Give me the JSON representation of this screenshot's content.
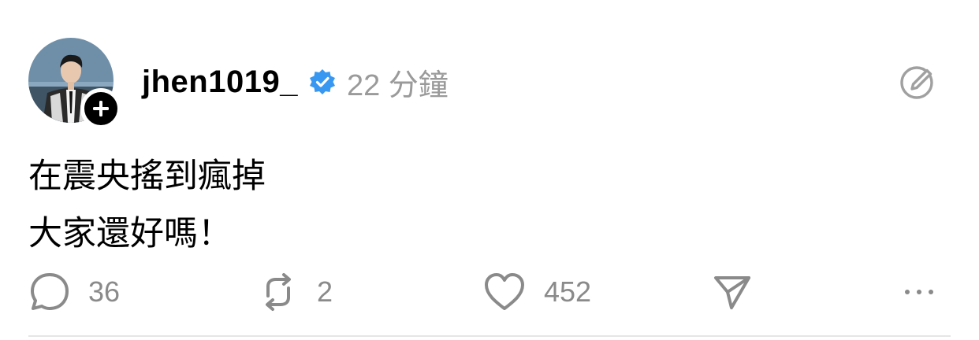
{
  "post": {
    "username": "jhen1019_",
    "timestamp": "22 分鐘",
    "verified": true,
    "lines": [
      "在震央搖到瘋掉",
      "大家還好嗎！"
    ]
  },
  "actions": {
    "replies": "36",
    "reposts": "2",
    "likes": "452"
  },
  "icons": {
    "avatar": "profile-photo",
    "follow": "plus-icon",
    "verified": "verified-badge-icon",
    "edit": "edit-pencil-circle-icon",
    "reply": "speech-bubble-icon",
    "repost": "repost-arrows-icon",
    "like": "heart-icon",
    "share": "send-icon",
    "more": "ellipsis-icon"
  },
  "colors": {
    "verified": "#3897f0",
    "muted": "#9a9a9a",
    "text": "#000000"
  }
}
